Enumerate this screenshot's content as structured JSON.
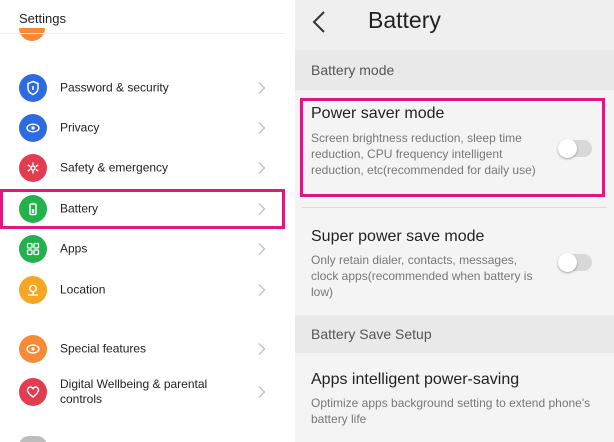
{
  "left": {
    "title": "Settings",
    "items": [
      {
        "label": "Password & security",
        "icon": "shield-icon",
        "color": "#2f6be0"
      },
      {
        "label": "Privacy",
        "icon": "eye-icon",
        "color": "#2f6be0"
      },
      {
        "label": "Safety & emergency",
        "icon": "asterisk-icon",
        "color": "#e23d4f"
      },
      {
        "label": "Battery",
        "icon": "battery-icon",
        "color": "#23b14d"
      },
      {
        "label": "Apps",
        "icon": "apps-grid-icon",
        "color": "#23b14d"
      },
      {
        "label": "Location",
        "icon": "location-pin-icon",
        "color": "#f5a623"
      },
      {
        "label": "Special features",
        "icon": "star-eye-icon",
        "color": "#f58a37"
      },
      {
        "label": "Digital Wellbeing & parental controls",
        "icon": "heart-icon",
        "color": "#e23d4f"
      }
    ],
    "highlight_color": "#e0177d"
  },
  "right": {
    "title": "Battery",
    "sections": {
      "battery_mode": "Battery mode",
      "battery_save_setup": "Battery Save Setup"
    },
    "power_saver": {
      "title": "Power saver mode",
      "desc": "Screen brightness reduction, sleep time reduction, CPU frequency intelligent reduction, etc(recommended for daily use)",
      "enabled": false
    },
    "super_power_save": {
      "title": "Super power save mode",
      "desc": "Only retain dialer, contacts, messages, clock apps(recommended when battery is low)",
      "enabled": false
    },
    "apps_power_saving": {
      "title": "Apps intelligent power-saving",
      "desc": "Optimize apps background setting to extend phone's battery life"
    }
  }
}
